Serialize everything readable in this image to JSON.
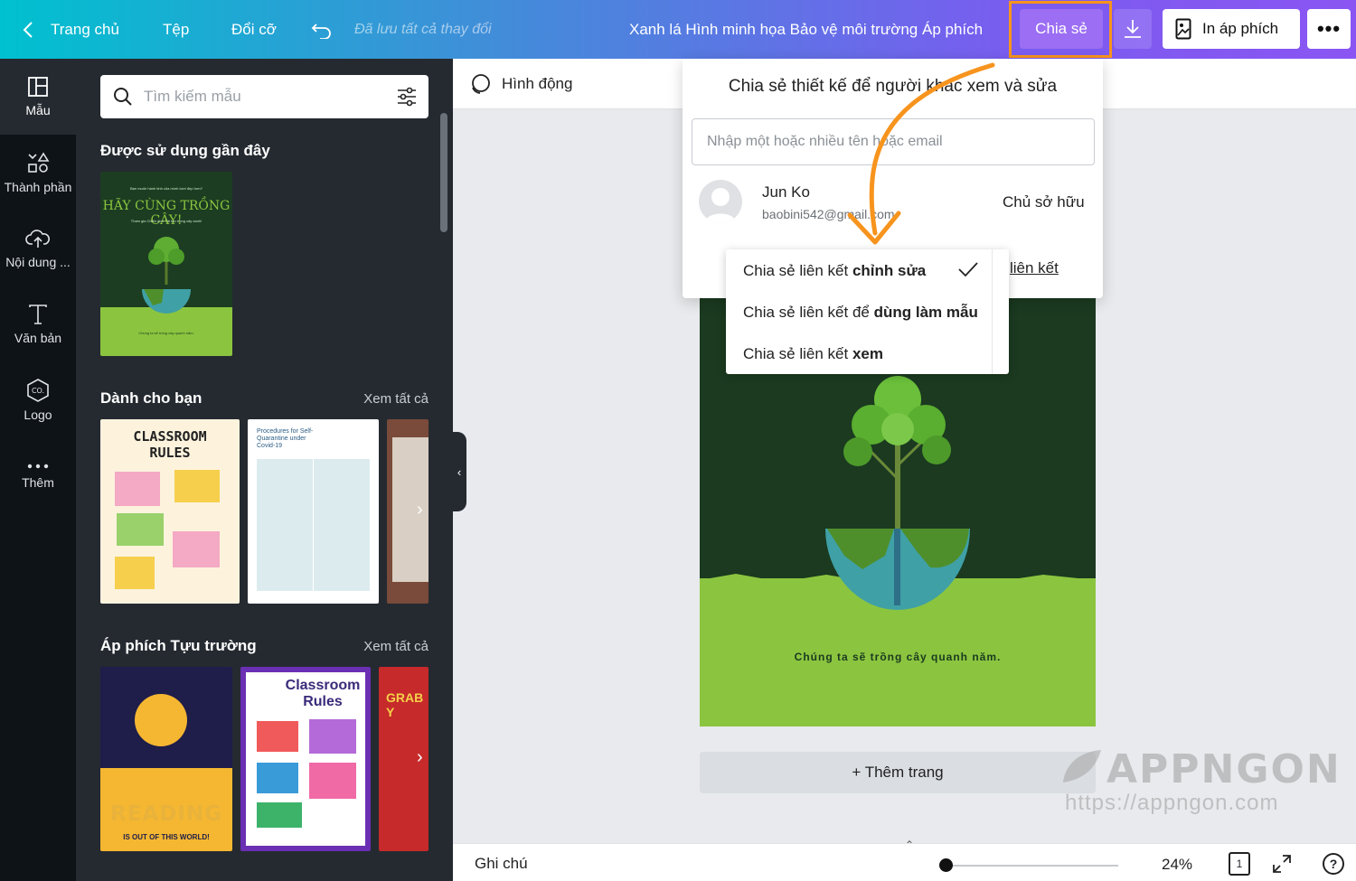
{
  "topbar": {
    "home": "Trang chủ",
    "file": "Tệp",
    "resize": "Đổi cỡ",
    "saved": "Đã lưu tất cả thay đổi",
    "title": "Xanh lá Hình minh họa Bảo vệ môi trường Áp phích",
    "share": "Chia sẻ",
    "print": "In áp phích",
    "more": "•••"
  },
  "rail": [
    {
      "label": "Mẫu"
    },
    {
      "label": "Thành phần"
    },
    {
      "label": "Nội dung ..."
    },
    {
      "label": "Văn bản"
    },
    {
      "label": "Logo"
    },
    {
      "label": "Thêm"
    }
  ],
  "panel": {
    "search_placeholder": "Tìm kiếm mẫu",
    "recent_title": "Được sử dụng gần đây",
    "for_you_title": "Dành cho bạn",
    "see_all": "Xem tất cả",
    "school_title": "Áp phích Tựu trường",
    "thumbs": {
      "recent_line1": "Bạn muốn hành tinh của mình tươi đẹp hơn?",
      "recent_heading": "HÃY CÙNG TRỒNG CÂY!",
      "recent_line2": "Tham gia Chiến dịch Tái tạo trồng cây xanh!",
      "recent_footer": "Chúng ta sẽ trồng cây quanh năm.",
      "classroom": "CLASSROOM RULES",
      "procedures": "Procedures for Self-Quarantine under Covid-19",
      "classroom2": "Classroom Rules",
      "reading": "READING",
      "reading_sub": "IS OUT OF THIS WORLD!",
      "grab": "GRAB Y"
    }
  },
  "canvas": {
    "animate": "Hình động",
    "poster_caption": "Chúng ta sẽ trồng cây quanh năm.",
    "add_page": "+ Thêm trang"
  },
  "bottom": {
    "notes": "Ghi chú",
    "zoom": "24%",
    "page_num": "1",
    "help": "?"
  },
  "share_popup": {
    "title": "Chia sẻ thiết kế để người khác xem và sửa",
    "email_placeholder": "Nhập một hoặc nhiều tên hoặc email",
    "user_name": "Jun Ko",
    "user_email": "baobini542@gmail.com",
    "owner": "Chủ sở hữu",
    "link_label": "liên kết"
  },
  "dropdown": [
    {
      "prefix": "Chia sẻ liên kết ",
      "bold": "chỉnh sửa",
      "checked": true
    },
    {
      "prefix": "Chia sẻ liên kết để ",
      "bold": "dùng làm mẫu",
      "checked": false
    },
    {
      "prefix": "Chia sẻ liên kết ",
      "bold": "xem",
      "checked": false
    }
  ],
  "watermark": {
    "brand": "APPNGON",
    "url": "https://appngon.com"
  },
  "colors": {
    "accent_orange": "#f7941d",
    "share_purple": "#9b6ef3",
    "poster_dark": "#1b3a20",
    "poster_grass": "#8bc53f"
  }
}
